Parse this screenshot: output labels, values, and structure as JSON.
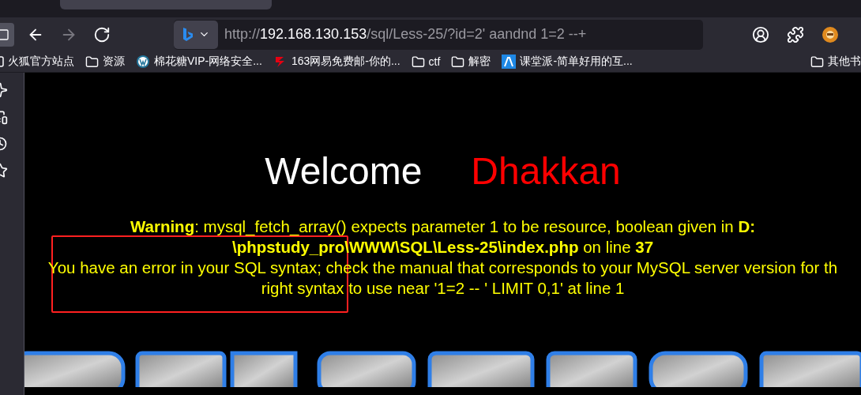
{
  "toolbar": {
    "buttons": [
      {
        "kind": "sidebar",
        "disabled": false
      },
      {
        "kind": "back",
        "disabled": false
      },
      {
        "kind": "forward",
        "disabled": true
      },
      {
        "kind": "reload",
        "disabled": false
      }
    ],
    "address": {
      "scheme": "http://",
      "host": "192.168.130.153",
      "path": "/sql/Less-25/?id=2' aandnd 1=2 --+"
    }
  },
  "bookmarks": [
    {
      "kind": "site",
      "label": "火狐官方站点"
    },
    {
      "kind": "folder",
      "label": "资源"
    },
    {
      "kind": "wordpress",
      "label": "棉花糖VIP-网络安全..."
    },
    {
      "kind": "mail",
      "label": "163网易免费邮-你的..."
    },
    {
      "kind": "folder",
      "label": "ctf"
    },
    {
      "kind": "folder",
      "label": "解密"
    },
    {
      "kind": "app",
      "label": "课堂派-简单好用的互..."
    },
    {
      "kind": "spacer"
    },
    {
      "kind": "folder",
      "label": "其他书"
    }
  ],
  "page": {
    "welcome": "Welcome",
    "name": "Dhakkan",
    "warning": {
      "label": "Warning",
      "text": ": mysql_fetch_array() expects parameter 1 to be resource, boolean given in ",
      "file": "D:\\phpstudy_pro\\WWW\\SQL\\Less-25\\index.php",
      "on_line": " on line ",
      "line": "37"
    },
    "error_lines": [
      "You have an error in your SQL syntax; check the manual that corresponds to your MySQL server version for th",
      "right syntax to use near '1=2 -- ' LIMIT 0,1' at line 1"
    ]
  }
}
